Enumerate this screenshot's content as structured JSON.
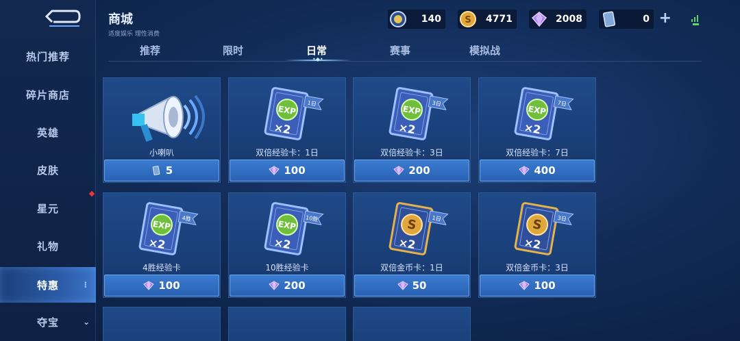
{
  "sidebar": {
    "items": [
      {
        "label": "热门推荐"
      },
      {
        "label": "碎片商店"
      },
      {
        "label": "英雄"
      },
      {
        "label": "皮肤"
      },
      {
        "label": "星元"
      },
      {
        "label": "礼物"
      },
      {
        "label": "特惠"
      },
      {
        "label": "夺宝"
      }
    ],
    "active_index": 6
  },
  "header": {
    "title": "商城",
    "subtitle": "适度娱乐 理性消费"
  },
  "currencies": [
    {
      "icon": "medal-coin-icon",
      "value": "140"
    },
    {
      "icon": "gold-coin-icon",
      "value": "4771"
    },
    {
      "icon": "diamond-icon",
      "value": "2008"
    },
    {
      "icon": "voucher-card-icon",
      "value": "0"
    }
  ],
  "tabs": [
    {
      "label": "推荐"
    },
    {
      "label": "限时"
    },
    {
      "label": "日常"
    },
    {
      "label": "赛事"
    },
    {
      "label": "模拟战"
    }
  ],
  "active_tab": 2,
  "items": [
    {
      "name": "小喇叭",
      "price": "5",
      "price_icon": "voucher-card-icon",
      "art": "megaphone"
    },
    {
      "name": "双倍经验卡：1日",
      "price": "100",
      "price_icon": "diamond-icon",
      "art": "exp",
      "tag": "1日"
    },
    {
      "name": "双倍经验卡：3日",
      "price": "200",
      "price_icon": "diamond-icon",
      "art": "exp",
      "tag": "3日"
    },
    {
      "name": "双倍经验卡：7日",
      "price": "400",
      "price_icon": "diamond-icon",
      "art": "exp",
      "tag": "7日"
    },
    {
      "name": "4胜经验卡",
      "price": "100",
      "price_icon": "diamond-icon",
      "art": "exp",
      "tag": "4胜"
    },
    {
      "name": "10胜经验卡",
      "price": "200",
      "price_icon": "diamond-icon",
      "art": "exp",
      "tag": "10胜"
    },
    {
      "name": "双倍金币卡：1日",
      "price": "50",
      "price_icon": "diamond-icon",
      "art": "gold",
      "tag": "1日"
    },
    {
      "name": "双倍金币卡：3日",
      "price": "100",
      "price_icon": "diamond-icon",
      "art": "gold",
      "tag": "3日"
    }
  ],
  "card_art_text": {
    "exp": "EXP",
    "multiplier": "×2",
    "coin": "S"
  },
  "colors": {
    "accent": "#3a7bd0",
    "gem": "#b07cff",
    "gold": "#e0a73c",
    "alert": "#e8363b"
  }
}
